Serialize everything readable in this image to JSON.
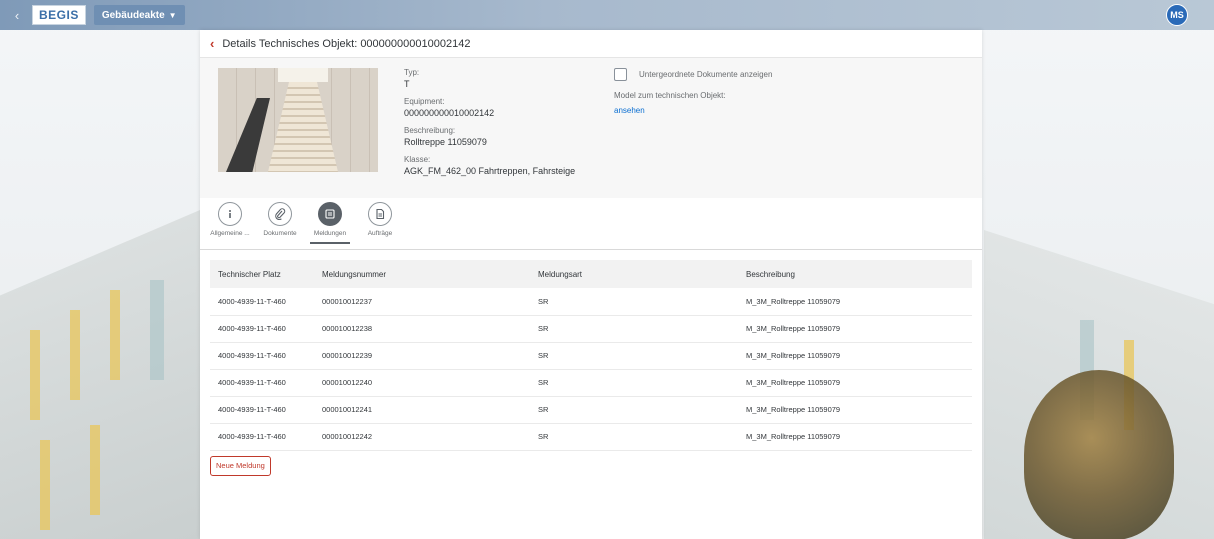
{
  "shell": {
    "logo": "BEGIS",
    "app_menu": "Gebäudeakte",
    "user_initials": "MS"
  },
  "page": {
    "title": "Details Technisches Objekt: 000000000010002142"
  },
  "object": {
    "typ_label": "Typ:",
    "typ_value": "T",
    "equipment_label": "Equipment:",
    "equipment_value": "000000000010002142",
    "beschreibung_label": "Beschreibung:",
    "beschreibung_value": "Rolltreppe 11059079",
    "klasse_label": "Klasse:",
    "klasse_value": "AGK_FM_462_00 Fahrtreppen, Fahrsteige",
    "checkbox_label": "Untergeordnete Dokumente anzeigen",
    "model_label": "Model zum technischen Objekt:",
    "model_link": "ansehen"
  },
  "tabs": [
    {
      "label": "Allgemeine ...",
      "icon": "info-icon"
    },
    {
      "label": "Dokumente",
      "icon": "attachment-icon"
    },
    {
      "label": "Meldungen",
      "icon": "notification-icon"
    },
    {
      "label": "Aufträge",
      "icon": "document-icon"
    }
  ],
  "table": {
    "columns": [
      "Technischer Platz",
      "Meldungsnummer",
      "Meldungsart",
      "Beschreibung"
    ],
    "rows": [
      [
        "4000-4939-11-T-460",
        "000010012237",
        "SR",
        "M_3M_Rolltreppe 11059079"
      ],
      [
        "4000-4939-11-T-460",
        "000010012238",
        "SR",
        "M_3M_Rolltreppe 11059079"
      ],
      [
        "4000-4939-11-T-460",
        "000010012239",
        "SR",
        "M_3M_Rolltreppe 11059079"
      ],
      [
        "4000-4939-11-T-460",
        "000010012240",
        "SR",
        "M_3M_Rolltreppe 11059079"
      ],
      [
        "4000-4939-11-T-460",
        "000010012241",
        "SR",
        "M_3M_Rolltreppe 11059079"
      ],
      [
        "4000-4939-11-T-460",
        "000010012242",
        "SR",
        "M_3M_Rolltreppe 11059079"
      ]
    ]
  },
  "actions": {
    "new_notification": "Neue Meldung"
  },
  "colors": {
    "accent": "#c0392b",
    "link": "#0a6ed1",
    "avatar": "#2a6ab8"
  }
}
